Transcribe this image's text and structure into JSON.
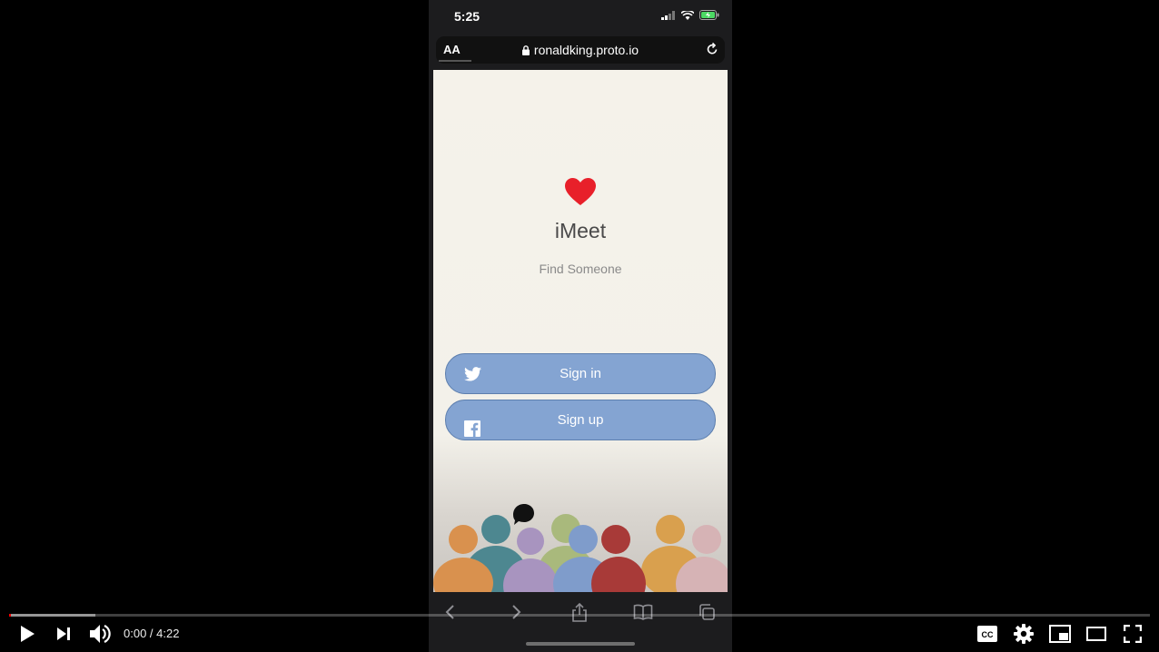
{
  "status_bar": {
    "time": "5:25"
  },
  "browser": {
    "text_size_label": "AA",
    "url": "ronaldking.proto.io"
  },
  "app": {
    "title": "iMeet",
    "tagline": "Find Someone",
    "signin_label": "Sign in",
    "signup_label": "Sign up",
    "heart_color": "#e8202a",
    "button_color": "#84a4d2"
  },
  "player": {
    "current_time": "0:00",
    "duration": "4:22",
    "time_separator": " / ",
    "played_fraction": 0,
    "buffered_fraction": 0.076,
    "progress_color": "#ff0000"
  }
}
